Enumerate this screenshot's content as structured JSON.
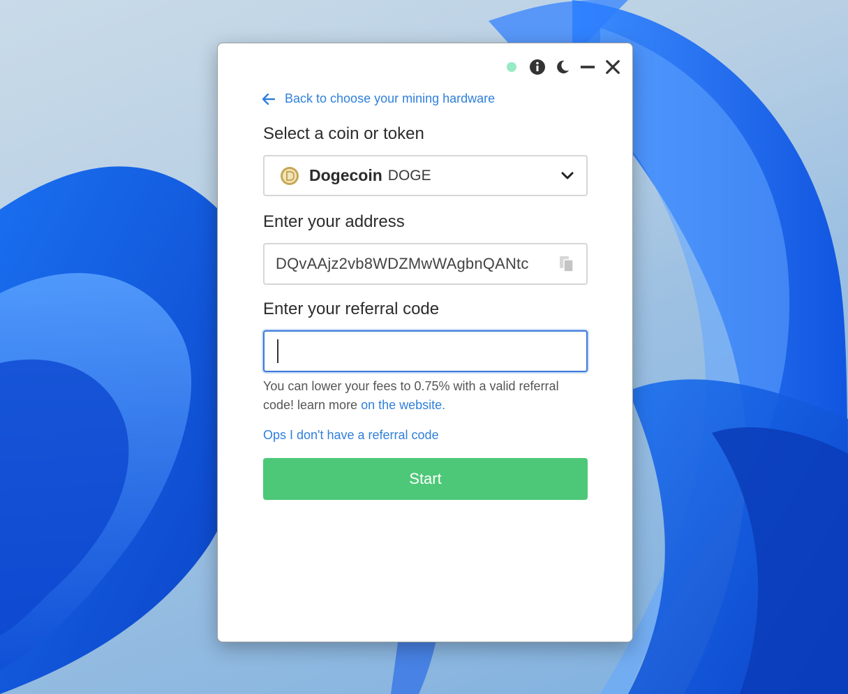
{
  "colors": {
    "accent": "#2f7fdb",
    "start_button": "#4dc878",
    "status_dot": "#97eac3",
    "focus_border": "#3c78d8"
  },
  "window_controls": {
    "status": "status-dot",
    "icons": [
      "info-icon",
      "moon-icon",
      "minimize-icon",
      "close-icon"
    ]
  },
  "nav": {
    "back_label": "Back to choose your mining hardware"
  },
  "coin_section": {
    "label": "Select a coin or token",
    "selected_name": "Dogecoin",
    "selected_ticker": "DOGE",
    "icon": "dogecoin-icon"
  },
  "address_section": {
    "label": "Enter your address",
    "value": "DQvAAjz2vb8WDZMwWAgbnQANtc",
    "icon": "paste-icon"
  },
  "referral_section": {
    "label": "Enter your referral code",
    "value": "",
    "hint_text": "You can lower your fees to 0.75% with a valid referral code! learn more ",
    "hint_link": "on the website.",
    "no_code_link": "Ops I don't have a referral code"
  },
  "actions": {
    "start_label": "Start"
  }
}
